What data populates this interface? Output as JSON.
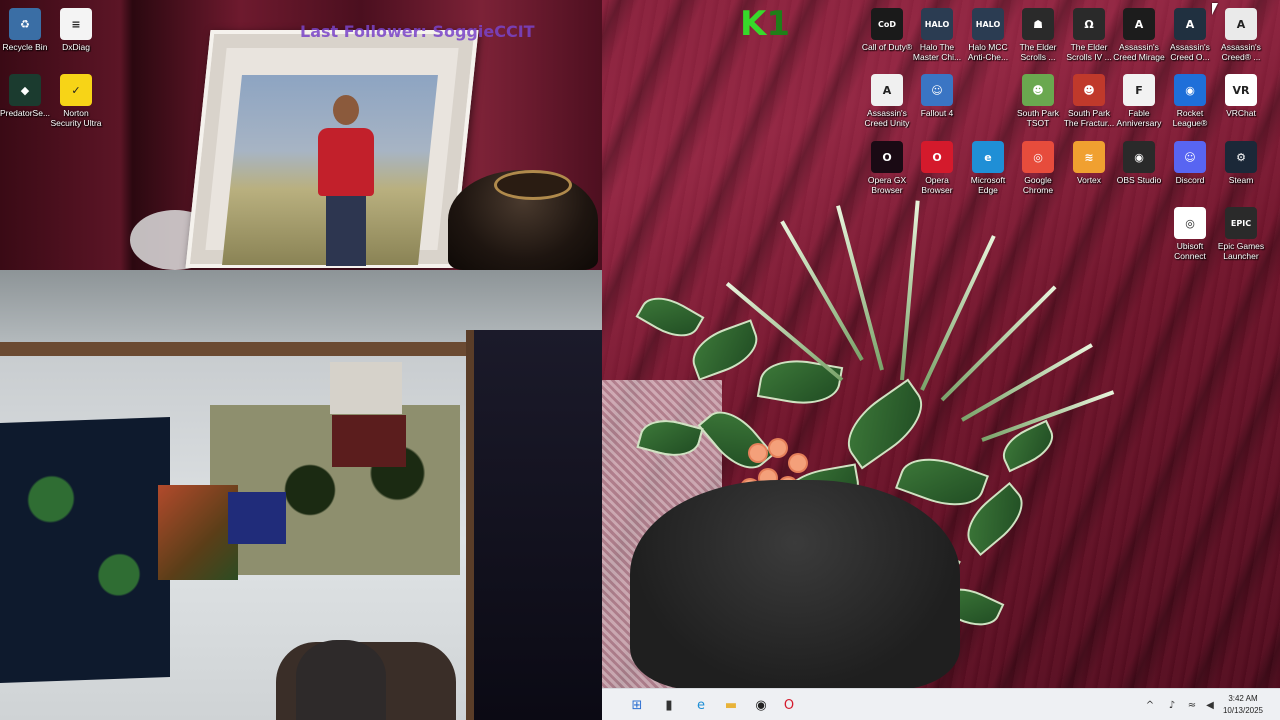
{
  "overlay": {
    "text": "Last Follower: SoggieCCIT",
    "logo_main": "K",
    "logo_dim": "1"
  },
  "desktop_icons": [
    {
      "label": "Recycle Bin",
      "icon": "recycle-bin-icon",
      "glyph": "♻",
      "bg": "#3a6ea5"
    },
    {
      "label": "DxDiag",
      "icon": "document-icon",
      "glyph": "≡",
      "bg": "#f4f4f4"
    },
    {
      "label": "PredatorSe...",
      "icon": "predator-sense-icon",
      "glyph": "◆",
      "bg": "#1b3b2f"
    },
    {
      "label": "Norton Security Ultra",
      "icon": "norton-icon",
      "glyph": "✓",
      "bg": "#f7d417"
    },
    {
      "label": "Call of Duty®",
      "icon": "call-of-duty-icon",
      "glyph": "CoD",
      "bg": "#1a1a1a"
    },
    {
      "label": "Halo The Master Chi...",
      "icon": "halo-mcc-icon",
      "glyph": "HALO",
      "bg": "#2b3c52"
    },
    {
      "label": "Halo MCC Anti-Che...",
      "icon": "halo-anticheat-icon",
      "glyph": "HALO",
      "bg": "#2b3c52"
    },
    {
      "label": "The Elder Scrolls ...",
      "icon": "elder-scrolls-icon",
      "glyph": "☗",
      "bg": "#2a2a2a"
    },
    {
      "label": "The Elder Scrolls IV ...",
      "icon": "oblivion-icon",
      "glyph": "Ω",
      "bg": "#2a2a2a"
    },
    {
      "label": "Assassin's Creed Mirage",
      "icon": "ac-mirage-icon",
      "glyph": "A",
      "bg": "#1c1c1c"
    },
    {
      "label": "Assassin's Creed O...",
      "icon": "ac-origins-icon",
      "glyph": "A",
      "bg": "#203040"
    },
    {
      "label": "Assassin's Creed® ...",
      "icon": "ac-creed-icon",
      "glyph": "A",
      "bg": "#eaeaea"
    },
    {
      "label": "Assassin's Creed Unity",
      "icon": "ac-unity-icon",
      "glyph": "A",
      "bg": "#f0f0f0"
    },
    {
      "label": "Fallout 4",
      "icon": "fallout-4-icon",
      "glyph": "☺",
      "bg": "#3a75c4"
    },
    {
      "label": "South Park TSOT",
      "icon": "south-park-tsot-icon",
      "glyph": "☻",
      "bg": "#6aa84f"
    },
    {
      "label": "South Park The Fractur...",
      "icon": "south-park-tfbw-icon",
      "glyph": "☻",
      "bg": "#c0392b"
    },
    {
      "label": "Fable Anniversary",
      "icon": "fable-icon",
      "glyph": "F",
      "bg": "#f2f2f2"
    },
    {
      "label": "Rocket League®",
      "icon": "rocket-league-icon",
      "glyph": "◉",
      "bg": "#1e6fd9"
    },
    {
      "label": "VRChat",
      "icon": "vrchat-icon",
      "glyph": "VR",
      "bg": "#ffffff"
    },
    {
      "label": "Opera GX Browser",
      "icon": "opera-gx-icon",
      "glyph": "O",
      "bg": "#1a0a14"
    },
    {
      "label": "Opera Browser",
      "icon": "opera-icon",
      "glyph": "O",
      "bg": "#d41a2c"
    },
    {
      "label": "Microsoft Edge",
      "icon": "edge-icon",
      "glyph": "e",
      "bg": "#1f8fd6"
    },
    {
      "label": "Google Chrome",
      "icon": "chrome-icon",
      "glyph": "◎",
      "bg": "#e74c3c"
    },
    {
      "label": "Vortex",
      "icon": "vortex-icon",
      "glyph": "≋",
      "bg": "#f0a030"
    },
    {
      "label": "OBS Studio",
      "icon": "obs-icon",
      "glyph": "◉",
      "bg": "#2a2a2a"
    },
    {
      "label": "Discord",
      "icon": "discord-icon",
      "glyph": "☺",
      "bg": "#5865f2"
    },
    {
      "label": "Steam",
      "icon": "steam-icon",
      "glyph": "⚙",
      "bg": "#1b2838"
    },
    {
      "label": "Ubisoft Connect",
      "icon": "ubisoft-icon",
      "glyph": "◎",
      "bg": "#ffffff"
    },
    {
      "label": "Epic Games Launcher",
      "icon": "epic-games-icon",
      "glyph": "EPIC",
      "bg": "#2a2a2a"
    }
  ],
  "taskbar": {
    "items": [
      {
        "name": "start-button-icon",
        "glyph": "⊞",
        "color": "#2c6fd1",
        "bg": "transparent"
      },
      {
        "name": "terminal-icon",
        "glyph": "▮",
        "color": "#333333",
        "bg": "transparent"
      },
      {
        "name": "edge-taskbar-icon",
        "glyph": "e",
        "color": "#1f8fd6",
        "bg": "transparent"
      },
      {
        "name": "file-explorer-icon",
        "glyph": "▬",
        "color": "#e8b339",
        "bg": "transparent"
      },
      {
        "name": "obs-taskbar-icon",
        "glyph": "◉",
        "color": "#222222",
        "bg": "transparent"
      },
      {
        "name": "opera-taskbar-icon",
        "glyph": "O",
        "color": "#d41a2c",
        "bg": "transparent"
      }
    ],
    "tray": [
      {
        "name": "chevron-up-icon",
        "glyph": "^"
      },
      {
        "name": "microphone-icon",
        "glyph": "♪"
      },
      {
        "name": "wifi-icon",
        "glyph": "≈"
      },
      {
        "name": "volume-icon",
        "glyph": "◀"
      }
    ],
    "time": "3:42 AM",
    "date": "10/13/2025"
  }
}
